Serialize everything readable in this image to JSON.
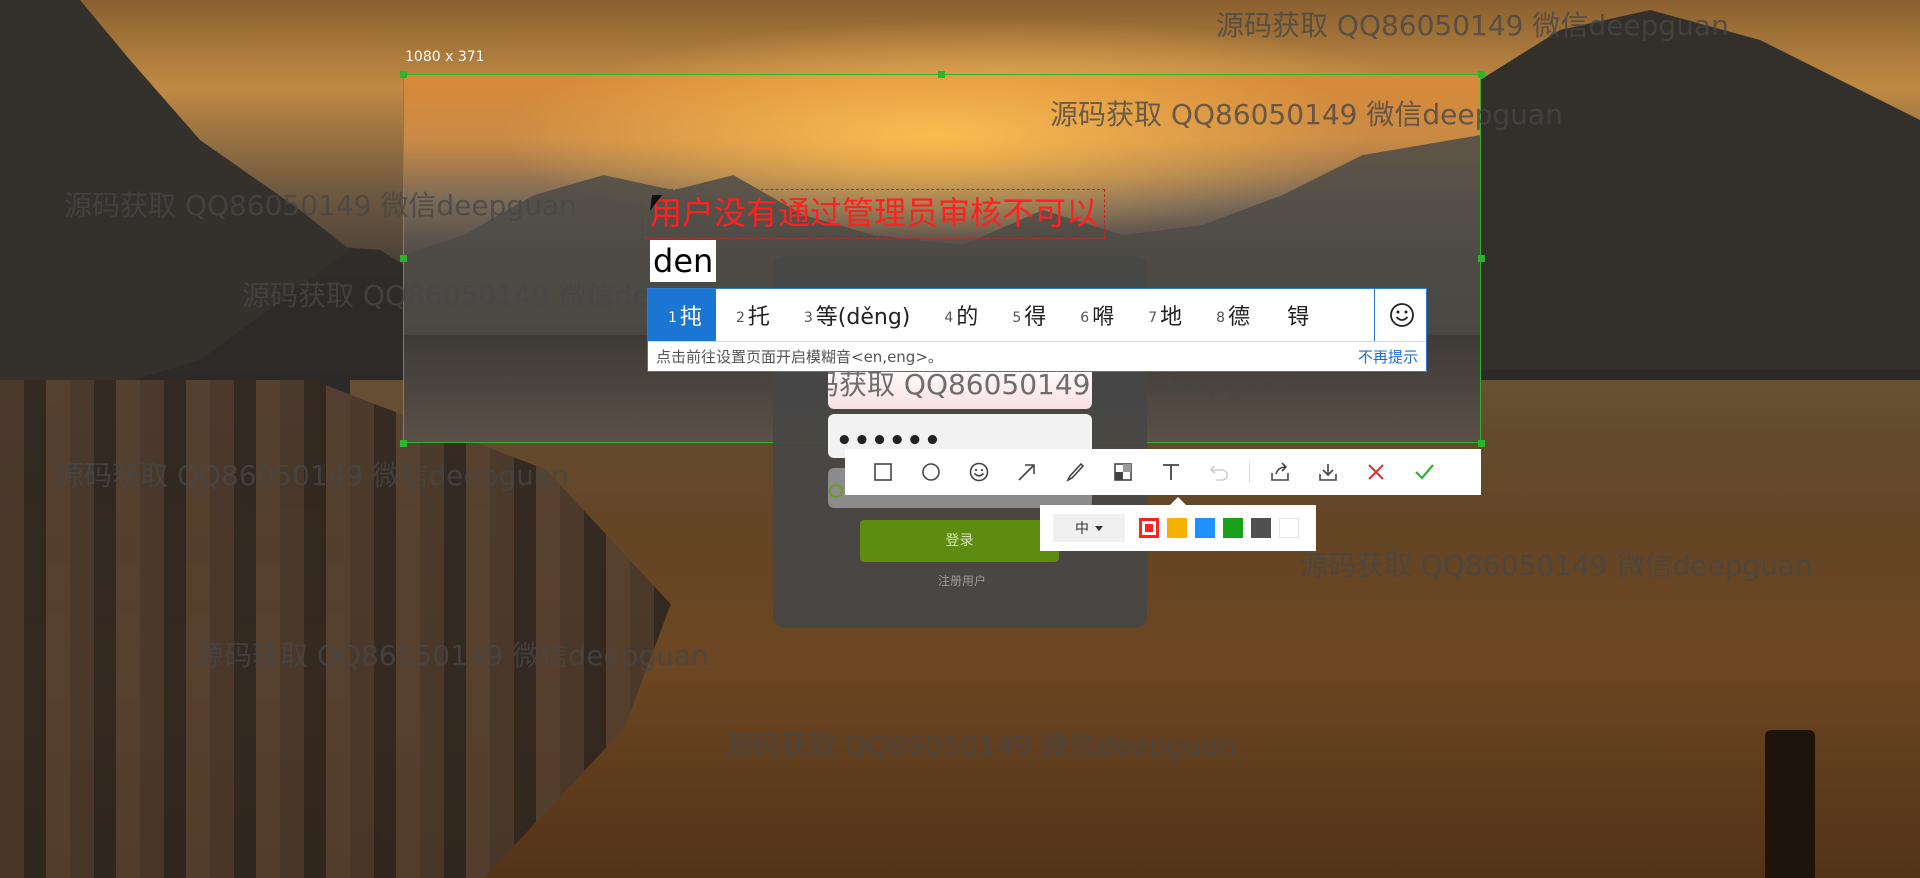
{
  "screenshot_tool": {
    "selection_size": "1080 x 371",
    "accent_color": "#2bb52b"
  },
  "watermark_text": "源码获取 QQ86050149 微信deepguan",
  "login_form": {
    "password_mask": "••••••",
    "login_button": "登录",
    "register_link": "注册用户",
    "button_color": "#5e8c10"
  },
  "annotation": {
    "text": "用户没有通过管理员审核不可以",
    "composition": "den",
    "color": "#ff2020"
  },
  "ime": {
    "candidates": [
      {
        "num": "1",
        "text": "扽"
      },
      {
        "num": "2",
        "text": "托"
      },
      {
        "num": "3",
        "text": "等(děng)"
      },
      {
        "num": "4",
        "text": "的"
      },
      {
        "num": "5",
        "text": "得"
      },
      {
        "num": "6",
        "text": "嘚"
      },
      {
        "num": "7",
        "text": "地"
      },
      {
        "num": "8",
        "text": "德"
      },
      {
        "num": "",
        "text": "锝"
      }
    ],
    "emoji_icon": "smiley-icon",
    "hint": "点击前往设置页面开启模糊音<en,eng>。",
    "dismiss": "不再提示",
    "active_color": "#1a76d2"
  },
  "toolbar": {
    "tools": [
      {
        "name": "rectangle-tool",
        "icon": "square-outline-icon"
      },
      {
        "name": "ellipse-tool",
        "icon": "circle-outline-icon"
      },
      {
        "name": "emoji-tool",
        "icon": "smiley-icon"
      },
      {
        "name": "arrow-tool",
        "icon": "arrow-up-right-icon"
      },
      {
        "name": "pen-tool",
        "icon": "brush-icon"
      },
      {
        "name": "mosaic-tool",
        "icon": "mosaic-icon"
      },
      {
        "name": "text-tool",
        "icon": "text-t-icon"
      },
      {
        "name": "undo-tool",
        "icon": "undo-icon"
      },
      {
        "name": "share-tool",
        "icon": "share-icon"
      },
      {
        "name": "save-tool",
        "icon": "download-icon"
      },
      {
        "name": "cancel-tool",
        "icon": "close-icon"
      },
      {
        "name": "confirm-tool",
        "icon": "check-icon"
      }
    ]
  },
  "style_panel": {
    "size_label": "中",
    "colors": [
      "#ff2020",
      "#f5b000",
      "#1e90ff",
      "#1aa01a",
      "#505050",
      "#ffffff"
    ],
    "selected_color": "#ff2020"
  }
}
